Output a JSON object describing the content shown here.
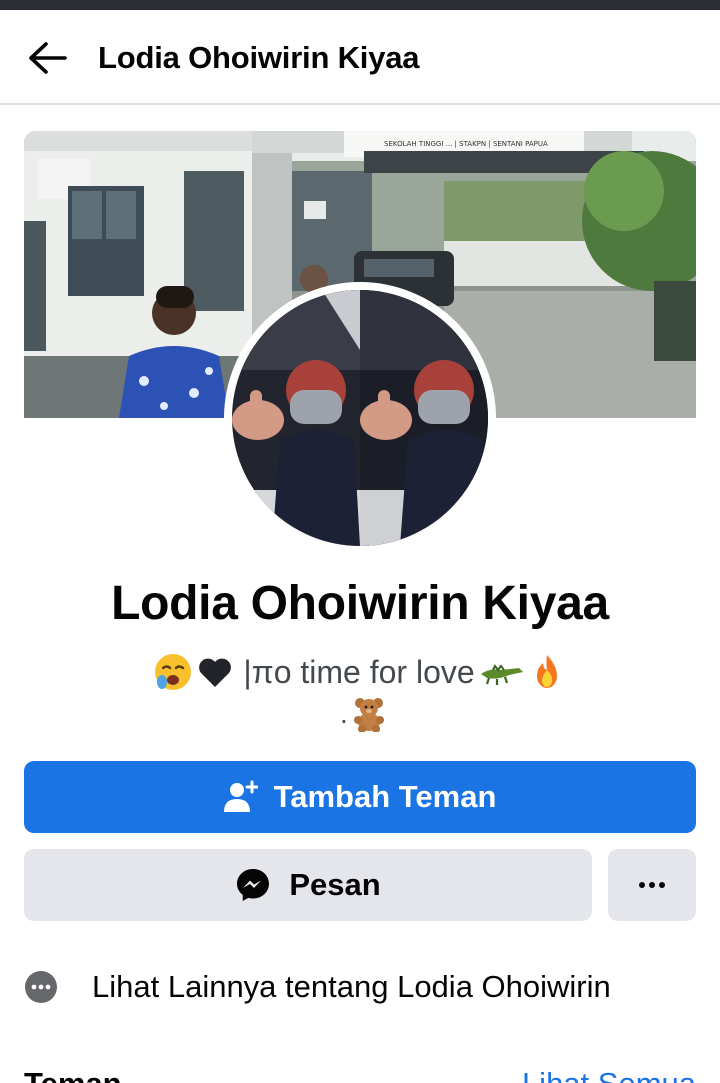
{
  "header": {
    "title": "Lodia Ohoiwirin Kiyaa",
    "back_icon": "arrow-left-icon"
  },
  "cover": {
    "sign_text": "SEKOLAH TINGGI ... | STAKPN | SENTANI PAPUA"
  },
  "profile": {
    "name": "Lodia Ohoiwirin Kiyaa",
    "bio_line1": "|πo time for love",
    "bio_emojis": [
      "yawning-face-icon",
      "black-heart-icon",
      "crocodile-icon",
      "fire-icon"
    ],
    "bio_line2_prefix": ".",
    "bio_line2_emoji": "teddy-bear-icon"
  },
  "actions": {
    "add_friend_label": "Tambah Teman",
    "add_friend_icon": "add-friend-icon",
    "message_label": "Pesan",
    "message_icon": "messenger-icon",
    "more_icon": "more-dots-icon"
  },
  "about": {
    "see_more_label": "Lihat Lainnya tentang Lodia Ohoiwirin",
    "see_more_icon": "more-circle-icon"
  },
  "friends": {
    "title": "Teman",
    "see_all_label": "Lihat Semua"
  },
  "colors": {
    "primary": "#1b74e4",
    "secondary_button": "#e4e6eb",
    "text": "#050505",
    "muted_text": "#444950"
  }
}
